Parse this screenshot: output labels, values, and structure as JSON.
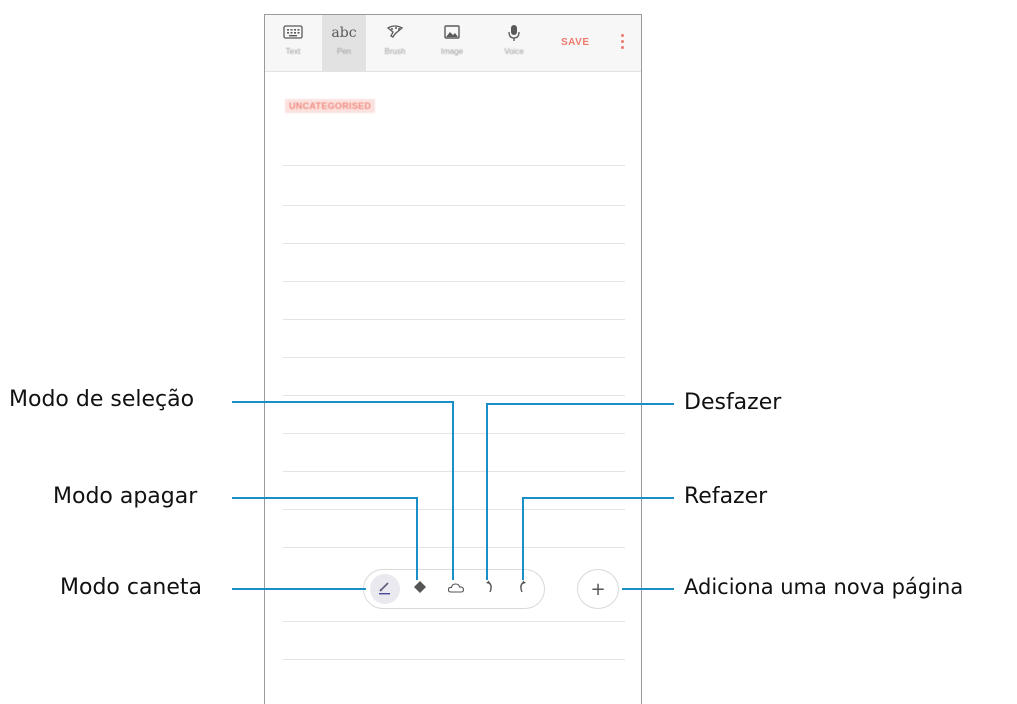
{
  "app": {
    "toolbar": {
      "tools": [
        {
          "name": "text",
          "label": "Text",
          "icon": "keyboard-icon"
        },
        {
          "name": "pen",
          "label": "Pen",
          "icon": "abc",
          "glyph": "abc",
          "active": true
        },
        {
          "name": "brush",
          "label": "Brush",
          "icon": "brush-icon"
        },
        {
          "name": "image",
          "label": "Image",
          "icon": "image-icon"
        },
        {
          "name": "voice",
          "label": "Voice",
          "icon": "microphone-icon"
        }
      ],
      "save_label": "SAVE",
      "more_icon": "more-vertical-icon"
    },
    "category_label": "UNCATEGORISED",
    "pen_toolbar": {
      "buttons": [
        {
          "name": "pen",
          "icon": "pen-icon",
          "active": true
        },
        {
          "name": "eraser",
          "icon": "eraser-icon"
        },
        {
          "name": "selection",
          "icon": "lasso-cloud-icon"
        },
        {
          "name": "undo",
          "icon": "undo-icon"
        },
        {
          "name": "redo",
          "icon": "redo-icon"
        }
      ],
      "add_page_icon": "plus-icon",
      "add_page_glyph": "+"
    }
  },
  "callouts": {
    "selection_mode": "Modo de seleção",
    "erase_mode": "Modo apagar",
    "pen_mode": "Modo caneta",
    "undo": "Desfazer",
    "redo": "Refazer",
    "add_page": "Adiciona uma nova página"
  },
  "colors": {
    "accent": "#ee7b6e",
    "callout_line": "#1a8fc7",
    "frame": "#9a9a9a"
  }
}
